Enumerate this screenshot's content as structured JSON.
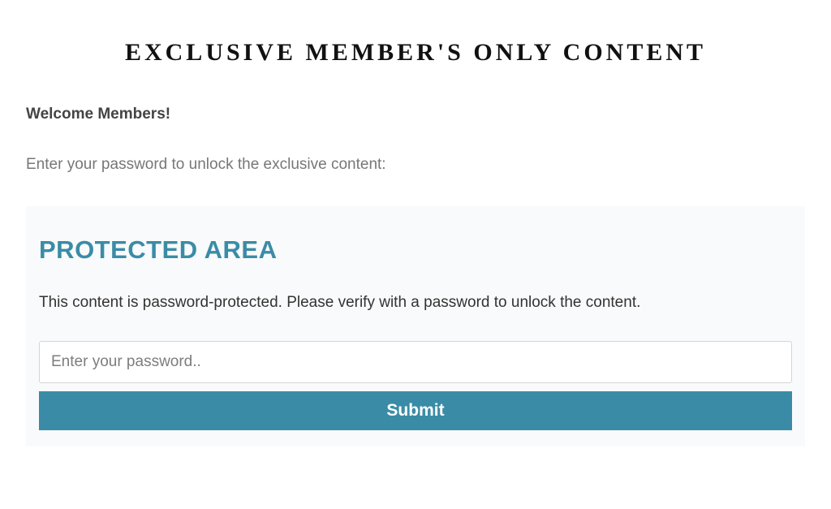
{
  "page": {
    "title": "EXCLUSIVE MEMBER'S ONLY CONTENT",
    "welcome": "Welcome Members!",
    "instruction": "Enter your password to unlock the exclusive content:"
  },
  "protected": {
    "heading": "PROTECTED AREA",
    "description": "This content is password-protected. Please verify with a password to unlock the content.",
    "password_placeholder": "Enter your password..",
    "submit_label": "Submit"
  },
  "colors": {
    "accent": "#3a8ca6",
    "box_bg": "#f9fafb"
  }
}
